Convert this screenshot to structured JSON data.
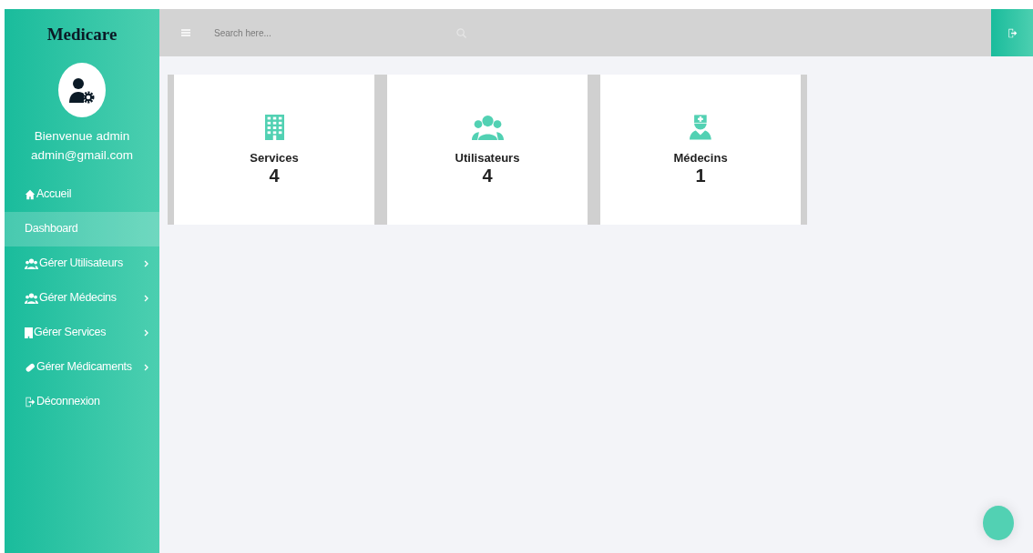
{
  "sidebar": {
    "brand": "Medicare",
    "welcome": "Bienvenue admin",
    "email": "admin@gmail.com",
    "items": [
      {
        "label": "Accueil",
        "kind": "home",
        "selected": false,
        "submenu": false
      },
      {
        "label": "Dashboard",
        "kind": "plain",
        "selected": true,
        "submenu": false
      },
      {
        "label": "Gérer Utilisateurs",
        "kind": "users",
        "selected": false,
        "submenu": true
      },
      {
        "label": "Gérer Médecins",
        "kind": "users",
        "selected": false,
        "submenu": true
      },
      {
        "label": "Gérer Services",
        "kind": "building",
        "selected": false,
        "submenu": true
      },
      {
        "label": "Gérer Médicaments",
        "kind": "pills",
        "selected": false,
        "submenu": true
      },
      {
        "label": "Déconnexion",
        "kind": "logout",
        "selected": false,
        "submenu": false
      }
    ]
  },
  "topbar": {
    "search": {
      "placeholder": "Search here..."
    }
  },
  "cards": [
    {
      "kind": "building",
      "label": "Services",
      "value": "4"
    },
    {
      "kind": "users",
      "label": "Utilisateurs",
      "value": "4"
    },
    {
      "kind": "doctor",
      "label": "Médecins",
      "value": "1"
    }
  ]
}
